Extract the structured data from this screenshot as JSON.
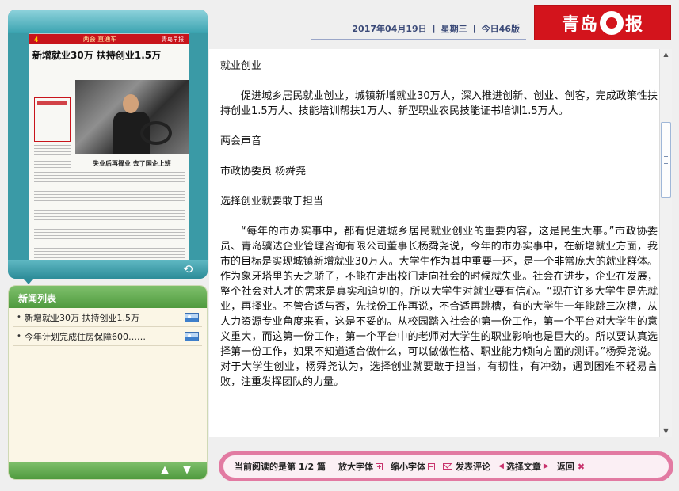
{
  "header": {
    "date": "2017年04月19日",
    "weekday": "星期三",
    "edition": "今日46版",
    "logo": "青岛早报",
    "logo_left": "青岛",
    "logo_right": "报"
  },
  "thumbnail": {
    "page_number": "4",
    "section": "两会 直通车",
    "brand": "青岛早报",
    "headline": "新增就业30万  扶持创业1.5万",
    "subhead": "失业后再择业  去了国企上班"
  },
  "news_list": {
    "title": "新闻列表",
    "items": [
      {
        "label": "新增就业30万  扶持创业1.5万",
        "icon": "image-icon"
      },
      {
        "label": "今年计划完成住房保障600……",
        "icon": "image-icon"
      }
    ]
  },
  "article": {
    "paragraphs": [
      {
        "text": "就业创业",
        "indent": false
      },
      {
        "text": "促进城乡居民就业创业，城镇新增就业30万人，深入推进创新、创业、创客，完成政策性扶持创业1.5万人、技能培训帮扶1万人、新型职业农民技能证书培训1.5万人。",
        "indent": true
      },
      {
        "text": "两会声音",
        "indent": false
      },
      {
        "text": "市政协委员  杨舜尧",
        "indent": false
      },
      {
        "text": "选择创业就要敢于担当",
        "indent": false
      },
      {
        "text": "“每年的市办实事中，都有促进城乡居民就业创业的重要内容，这是民生大事。”市政协委员、青岛骥达企业管理咨询有限公司董事长杨舜尧说，今年的市办实事中，在新增就业方面，我市的目标是实现城镇新增就业30万人。大学生作为其中重要一环，是一个非常庞大的就业群体。作为象牙塔里的天之骄子，不能在走出校门走向社会的时候就失业。社会在进步，企业在发展，整个社会对人才的需求是真实和迫切的，所以大学生对就业要有信心。“现在许多大学生是先就业，再择业。不管合适与否，先找份工作再说，不合适再跳槽，有的大学生一年能跳三次槽，从人力资源专业角度来看，这是不妥的。从校园踏入社会的第一份工作，第一个平台对大学生的意义重大，而这第一份工作，第一个平台中的老师对大学生的职业影响也是巨大的。所以要认真选择第一份工作，如果不知道适合做什么，可以做做性格、职业能力倾向方面的测评。”杨舜尧说。对于大学生创业，杨舜尧认为，选择创业就要敢于担当，有韧性，有冲劲，遇到困难不轻易言败，注重发挥团队的力量。",
        "indent": true
      }
    ]
  },
  "toolbar": {
    "reading": "当前阅读的是第  1/2  篇",
    "zoom_in": "放大字体",
    "zoom_out": "缩小字体",
    "comment": "发表评论",
    "choose": "选择文章",
    "back": "返回"
  },
  "colors": {
    "brand_red": "#d3141c",
    "teal": "#3a9aa6",
    "green": "#5aa648",
    "pink": "#e27aa2",
    "date_text": "#3b4a78"
  }
}
